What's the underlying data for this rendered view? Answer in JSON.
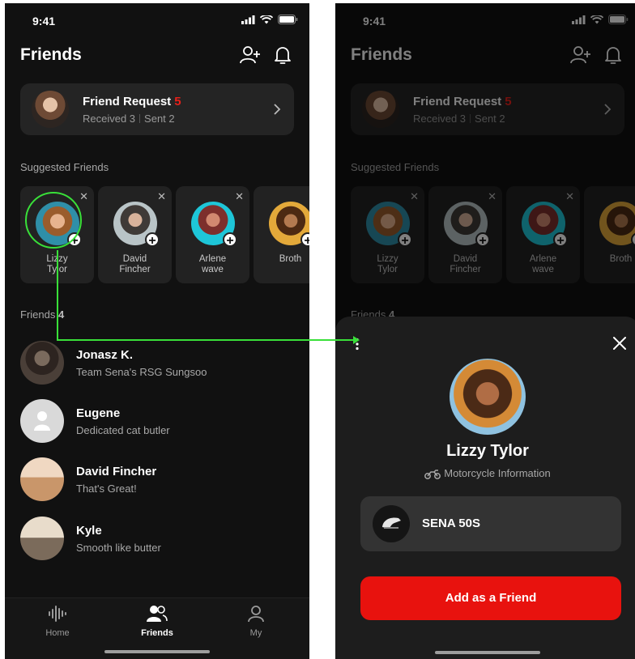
{
  "status": {
    "time": "9:41"
  },
  "header": {
    "title": "Friends"
  },
  "friend_request": {
    "title": "Friend Request",
    "count": "5",
    "received": "Received 3",
    "sent": "Sent 2"
  },
  "suggested": {
    "label": "Suggested Friends",
    "items": [
      {
        "name": "Lizzy\nTylor"
      },
      {
        "name": "David\nFincher"
      },
      {
        "name": "Arlene\nwave"
      },
      {
        "name": "Broth"
      }
    ]
  },
  "friends": {
    "label": "Friends",
    "count": "4",
    "items": [
      {
        "name": "Jonasz K.",
        "status": "Team Sena's RSG Sungsoo"
      },
      {
        "name": "Eugene",
        "status": "Dedicated cat butler"
      },
      {
        "name": "David Fincher",
        "status": "That's Great!"
      },
      {
        "name": "Kyle",
        "status": "Smooth like butter"
      }
    ]
  },
  "tabs": [
    {
      "label": "Home",
      "icon": "waveform-icon"
    },
    {
      "label": "Friends",
      "icon": "friends-icon"
    },
    {
      "label": "My",
      "icon": "person-icon"
    }
  ],
  "profile_sheet": {
    "name": "Lizzy Tylor",
    "moto_label": "Motorcycle Information",
    "device": "SENA 50S",
    "cta": "Add as a Friend"
  },
  "colors": {
    "accent": "#e8120e",
    "highlight": "#39e039",
    "background": "#111111"
  }
}
